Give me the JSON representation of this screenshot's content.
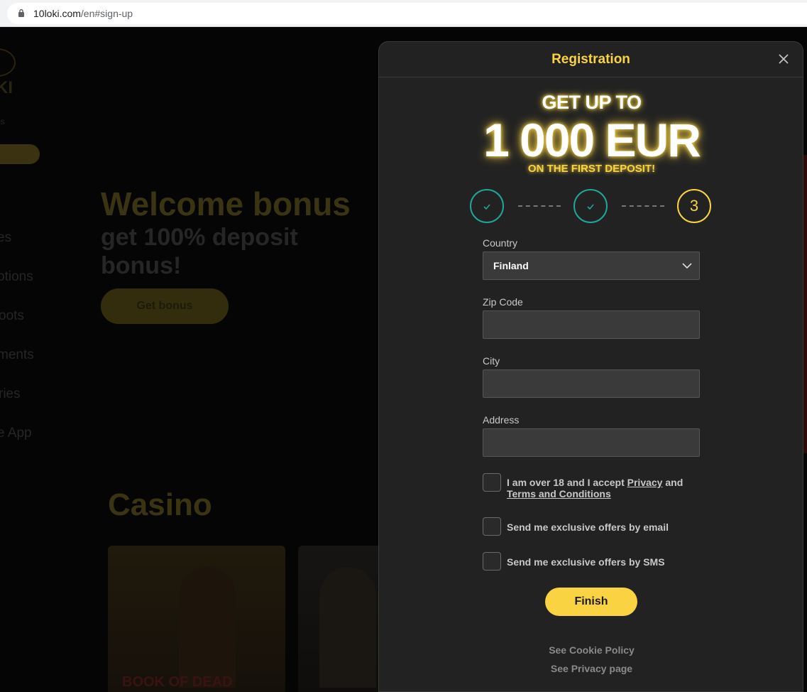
{
  "browser": {
    "url_domain": "10loki.com",
    "url_path": "/en#sign-up"
  },
  "background": {
    "logo_text": "KI",
    "side_items": [
      "ns",
      "es",
      "otions",
      "oots",
      "ments",
      "ries",
      "e App"
    ],
    "hero_title": "Welcome bonus",
    "hero_subtitle": "get 100% deposit bonus!",
    "hero_button": "Get bonus",
    "section_title": "Casino",
    "card1_label": "BOOK OF DEAD"
  },
  "modal": {
    "title": "Registration",
    "promo": {
      "line1": "GET UP TO",
      "amount": "1 000 EUR",
      "line3": "ON THE FIRST DEPOSIT!"
    },
    "steps": {
      "step1_icon": "check-icon",
      "step2_icon": "check-icon",
      "step3_label": "3"
    },
    "country": {
      "label": "Country",
      "value": "Finland"
    },
    "zip": {
      "label": "Zip Code",
      "value": ""
    },
    "city": {
      "label": "City",
      "value": ""
    },
    "address": {
      "label": "Address",
      "value": ""
    },
    "consent": {
      "prefix": "I am over 18 and I accept ",
      "privacy_link": "Privacy",
      "and": " and ",
      "terms_link": "Terms and Conditions"
    },
    "email_offers": "Send me exclusive offers by email",
    "sms_offers": "Send me exclusive offers by SMS",
    "finish_label": "Finish",
    "cookie_link": "See Cookie Policy",
    "privacy_page_link": "See Privacy page"
  },
  "colors": {
    "accent": "#f9d342",
    "teal": "#1fa69a",
    "modal_bg": "#222222"
  }
}
